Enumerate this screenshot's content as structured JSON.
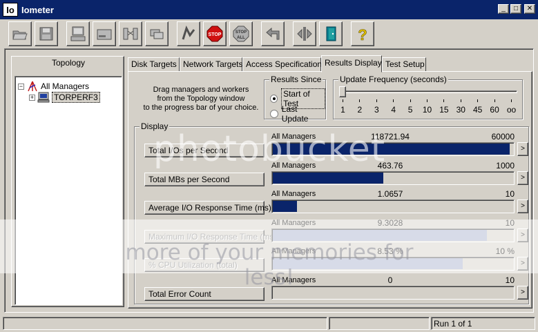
{
  "window": {
    "title": "Iometer",
    "icon_text": "Io"
  },
  "toolbar": {
    "buttons": [
      "open-config",
      "save-config",
      "new-manager",
      "new-disk-worker",
      "new-network-worker",
      "duplicate-worker",
      "start",
      "stop",
      "stop-all",
      "reset-workers",
      "exit",
      "quit",
      "about"
    ],
    "stop_label": "STOP",
    "stop_all_label": "STOP",
    "stop_all_sub": "ALL",
    "help_label": "?"
  },
  "topology": {
    "title": "Topology",
    "root_label": "All Managers",
    "manager_label": "TORPERF3",
    "collapse_sign": "−",
    "expand_sign": "+"
  },
  "tabs": [
    {
      "label": "Disk Targets"
    },
    {
      "label": "Network Targets"
    },
    {
      "label": "Access Specifications"
    },
    {
      "label": "Results Display"
    },
    {
      "label": "Test Setup"
    }
  ],
  "results": {
    "instructions": [
      "Drag managers and workers",
      "from the Topology window",
      "to the progress bar of your choice."
    ],
    "results_since": {
      "title": "Results Since",
      "options": [
        {
          "label": "Start of Test",
          "checked": true
        },
        {
          "label": "Last Update",
          "checked": false
        }
      ]
    },
    "update_frequency": {
      "title": "Update Frequency (seconds)",
      "ticks": [
        "1",
        "2",
        "3",
        "4",
        "5",
        "10",
        "15",
        "30",
        "45",
        "60",
        "oo"
      ],
      "selected": "1"
    },
    "display": {
      "title": "Display",
      "rows": [
        {
          "label": "Total I/Os per Second",
          "scope": "All Managers",
          "value": "118721.94",
          "max": "60000",
          "fill": 0.985,
          "enabled": true
        },
        {
          "label": "Total MBs per Second",
          "scope": "All Managers",
          "value": "463.76",
          "max": "1000",
          "fill": 0.46,
          "enabled": true
        },
        {
          "label": "Average I/O Response Time (ms)",
          "scope": "All Managers",
          "value": "1.0657",
          "max": "10",
          "fill": 0.1,
          "enabled": true
        },
        {
          "label": "Maximum I/O Response Time (ms)",
          "scope": "All Managers",
          "value": "9.3028",
          "max": "10",
          "fill": 0.89,
          "enabled": false
        },
        {
          "label": "% CPU Utilization (total)",
          "scope": "All Managers",
          "value": "8.53 %",
          "max": "10 %",
          "fill": 0.79,
          "enabled": false
        },
        {
          "label": "Total Error Count",
          "scope": "All Managers",
          "value": "0",
          "max": "10",
          "fill": 0,
          "enabled": true
        }
      ],
      "arrow": ">"
    }
  },
  "status": {
    "cells": [
      "",
      "",
      "Run 1 of 1"
    ]
  },
  "watermark": {
    "logo": "photobucket",
    "text": "more of your memories for less!"
  },
  "colors": {
    "titlebar": "#0a246a",
    "bar_fill": "#0a246a",
    "bar_fill_disabled": "#a6b0cc",
    "face": "#d4d0c8"
  }
}
